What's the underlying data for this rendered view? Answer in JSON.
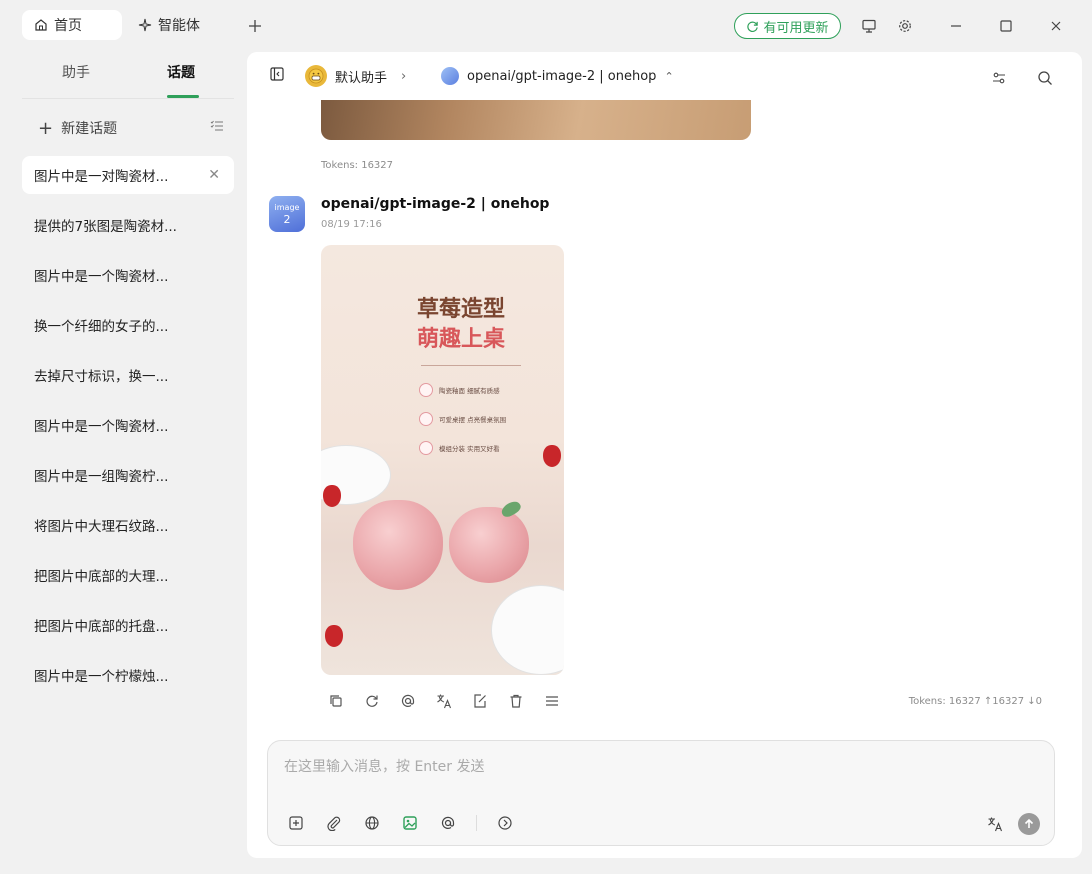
{
  "titlebar": {
    "tabs": [
      {
        "label": "首页",
        "icon": "home-icon",
        "active": true
      },
      {
        "label": "智能体",
        "icon": "sparkle-icon",
        "active": false
      }
    ],
    "update_label": "有可用更新",
    "accent": "#2fa05a"
  },
  "sidebar": {
    "tabs": [
      "助手",
      "话题"
    ],
    "new_topic_label": "新建话题",
    "topics": [
      "图片中是一对陶瓷材...",
      "提供的7张图是陶瓷材...",
      "图片中是一个陶瓷材...",
      "换一个纤细的女子的...",
      "去掉尺寸标识，换一...",
      "图片中是一个陶瓷材...",
      "图片中是一组陶瓷柠...",
      "将图片中大理石纹路...",
      "把图片中底部的大理...",
      "把图片中底部的托盘...",
      "图片中是一个柠檬烛..."
    ]
  },
  "header": {
    "assistant": "默认助手",
    "model": "openai/gpt-image-2 | onehop"
  },
  "messages": {
    "prev_tokens": "Tokens: 16327",
    "avatar_text1": "image",
    "avatar_text2": "2",
    "model_name": "openai/gpt-image-2 | onehop",
    "time": "08/19 17:16",
    "tokens": "Tokens: 16327 ↑16327 ↓0",
    "poster": {
      "title1": "草莓造型",
      "title2": "萌趣上桌",
      "features": [
        "陶瓷釉面 细腻有质感",
        "可爱桌摆 点亮餐桌氛围",
        "模组分装 实用又好看"
      ]
    }
  },
  "composer": {
    "placeholder": "在这里输入消息，按 Enter 发送"
  }
}
